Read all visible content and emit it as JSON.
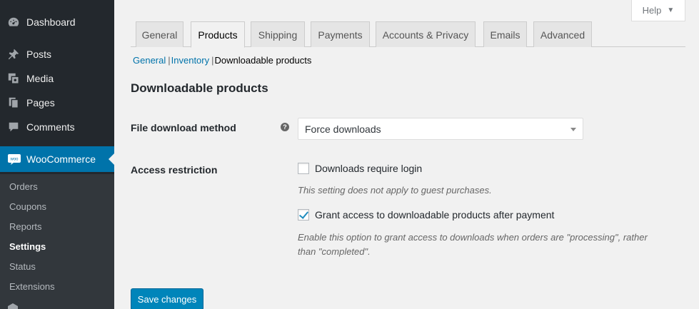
{
  "sidebar": {
    "items": [
      {
        "label": "Dashboard",
        "icon": "dashboard-icon"
      },
      {
        "label": "Posts",
        "icon": "pin-icon"
      },
      {
        "label": "Media",
        "icon": "media-icon"
      },
      {
        "label": "Pages",
        "icon": "pages-icon"
      },
      {
        "label": "Comments",
        "icon": "comment-icon"
      },
      {
        "label": "WooCommerce",
        "icon": "woocommerce-icon"
      }
    ],
    "woo_logo_text": "woo",
    "submenu": [
      "Orders",
      "Coupons",
      "Reports",
      "Settings",
      "Status",
      "Extensions"
    ],
    "current_submenu": "Settings"
  },
  "help": {
    "label": "Help",
    "caret": "▼"
  },
  "tabs": [
    {
      "label": "General"
    },
    {
      "label": "Products"
    },
    {
      "label": "Shipping"
    },
    {
      "label": "Payments"
    },
    {
      "label": "Accounts & Privacy"
    },
    {
      "label": "Emails"
    },
    {
      "label": "Advanced"
    }
  ],
  "active_tab": "Products",
  "subnav": {
    "items": [
      "General",
      "Inventory",
      "Downloadable products"
    ],
    "separator": "|",
    "current": "Downloadable products"
  },
  "section": {
    "title": "Downloadable products"
  },
  "file_download": {
    "label": "File download method",
    "help_tip": "?",
    "value": "Force downloads"
  },
  "access": {
    "label": "Access restriction",
    "require_login": {
      "label": "Downloads require login",
      "checked": false
    },
    "require_login_desc": "This setting does not apply to guest purchases.",
    "grant_access": {
      "label": "Grant access to downloadable products after payment",
      "checked": true
    },
    "grant_access_desc_line1": "Enable this option to grant access to downloads when orders are \"processing\", rather",
    "grant_access_desc_line2": "than \"completed\"."
  },
  "save_label": "Save changes",
  "colors": {
    "sidebar_bg": "#23282d",
    "submenu_bg": "#32373c",
    "accent": "#0073aa",
    "button": "#0085ba",
    "page_bg": "#f1f1f1"
  }
}
